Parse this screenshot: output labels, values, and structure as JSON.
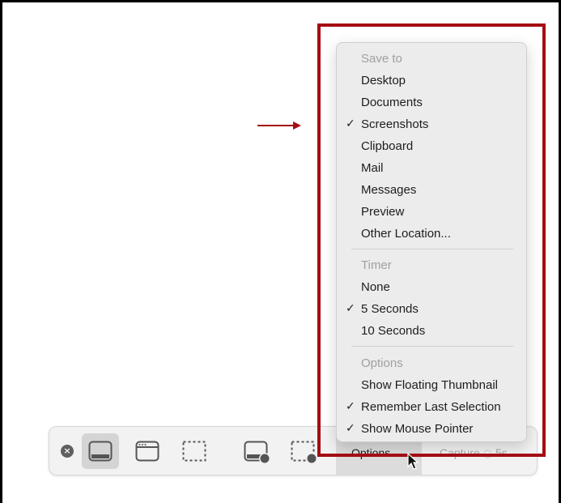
{
  "menu": {
    "sections": [
      {
        "header": "Save to",
        "items": [
          {
            "label": "Desktop",
            "checked": false
          },
          {
            "label": "Documents",
            "checked": false
          },
          {
            "label": "Screenshots",
            "checked": true
          },
          {
            "label": "Clipboard",
            "checked": false
          },
          {
            "label": "Mail",
            "checked": false
          },
          {
            "label": "Messages",
            "checked": false
          },
          {
            "label": "Preview",
            "checked": false
          },
          {
            "label": "Other Location...",
            "checked": false
          }
        ]
      },
      {
        "header": "Timer",
        "items": [
          {
            "label": "None",
            "checked": false
          },
          {
            "label": "5 Seconds",
            "checked": true
          },
          {
            "label": "10 Seconds",
            "checked": false
          }
        ]
      },
      {
        "header": "Options",
        "items": [
          {
            "label": "Show Floating Thumbnail",
            "checked": false
          },
          {
            "label": "Remember Last Selection",
            "checked": true
          },
          {
            "label": "Show Mouse Pointer",
            "checked": true
          }
        ]
      }
    ],
    "check_glyph": "✓"
  },
  "toolbar": {
    "close_glyph": "×",
    "options_label": "Options",
    "options_chevron": "⌄",
    "capture_label": "Capture",
    "capture_timer_glyph": "◌",
    "capture_timer_value": "5s",
    "buttons": [
      {
        "icon": "capture-entire-screen-icon"
      },
      {
        "icon": "capture-window-icon"
      },
      {
        "icon": "capture-selection-icon"
      },
      {
        "icon": "record-entire-screen-icon"
      },
      {
        "icon": "record-selection-icon"
      }
    ]
  },
  "colors": {
    "annotation": "#a30d12",
    "menu_bg": "#ececec",
    "toolbar_bg": "#f2f2f2"
  }
}
